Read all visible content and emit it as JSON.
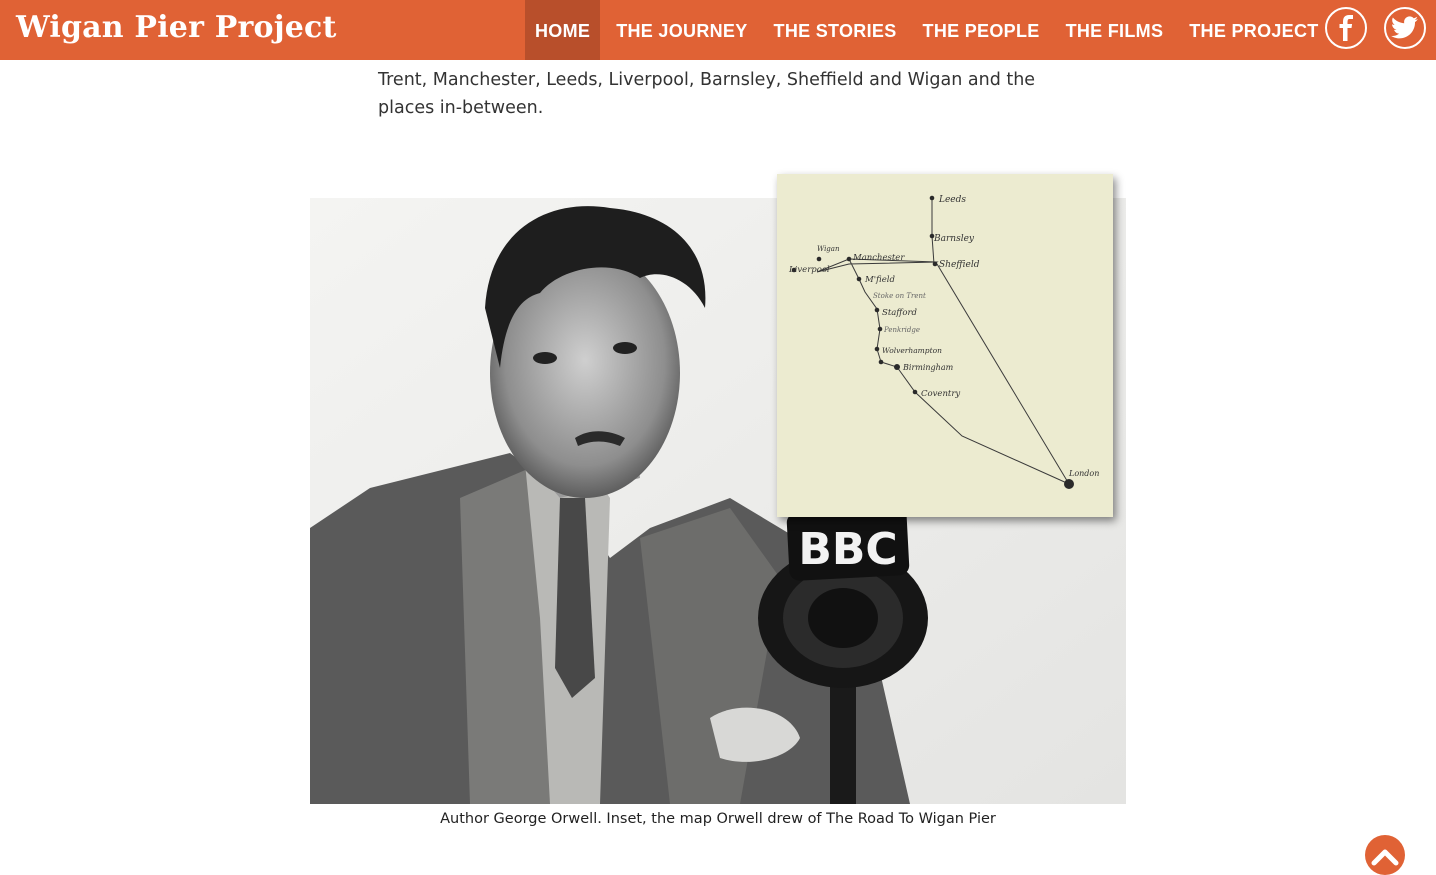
{
  "header": {
    "site_title": "Wigan Pier Project",
    "nav": [
      {
        "label": "HOME"
      },
      {
        "label": "THE JOURNEY"
      },
      {
        "label": "THE STORIES"
      },
      {
        "label": "THE PEOPLE"
      },
      {
        "label": "THE FILMS"
      },
      {
        "label": "THE PROJECT"
      }
    ],
    "active_index": 0,
    "social": [
      "facebook-icon",
      "twitter-icon"
    ]
  },
  "article": {
    "intro_text": "Trent, Manchester, Leeds, Liverpool, Barnsley, Sheffield and Wigan and the places in-between.",
    "figure": {
      "mic_label": "BBC",
      "map_places": [
        "Leeds",
        "Barnsley",
        "Sheffield",
        "Wigan",
        "Manchester",
        "Liverpool",
        "M'field",
        "Stoke on Trent",
        "Stafford",
        "Penkridge",
        "Wolverhampton",
        "Birmingham",
        "Coventry",
        "London"
      ],
      "caption": "Author George Orwell. Inset, the map Orwell drew of The Road To Wigan Pier"
    }
  },
  "colors": {
    "brand": "#e06235",
    "nav_active": "#b84f2b",
    "map_paper": "#ecebd0"
  }
}
